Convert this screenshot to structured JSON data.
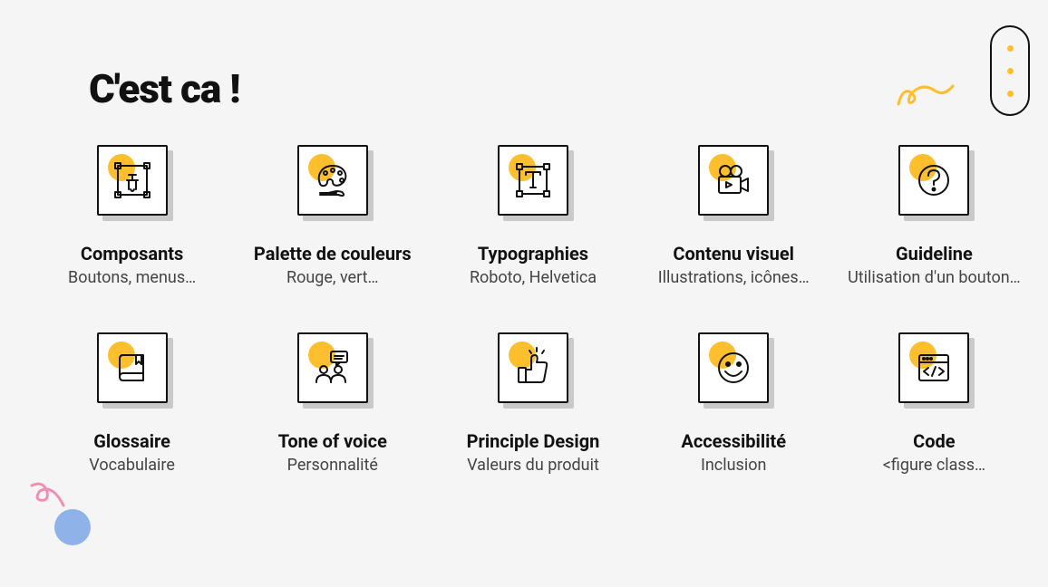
{
  "title": "C'est ca !",
  "cards": [
    {
      "icon": "components",
      "title": "Composants",
      "sub": "Boutons, menus…"
    },
    {
      "icon": "palette",
      "title": "Palette de couleurs",
      "sub": "Rouge, vert…"
    },
    {
      "icon": "typography",
      "title": "Typographies",
      "sub": "Roboto, Helvetica"
    },
    {
      "icon": "visual",
      "title": "Contenu visuel",
      "sub": "Illustrations, icônes…"
    },
    {
      "icon": "guideline",
      "title": "Guideline",
      "sub": "Utilisation d'un bouton…"
    },
    {
      "icon": "glossary",
      "title": "Glossaire",
      "sub": "Vocabulaire"
    },
    {
      "icon": "tone",
      "title": "Tone of voice",
      "sub": "Personnalité"
    },
    {
      "icon": "principle",
      "title": "Principle Design",
      "sub": "Valeurs du produit"
    },
    {
      "icon": "accessibility",
      "title": "Accessibilité",
      "sub": "Inclusion"
    },
    {
      "icon": "code",
      "title": "Code",
      "sub": "<figure class…"
    }
  ]
}
